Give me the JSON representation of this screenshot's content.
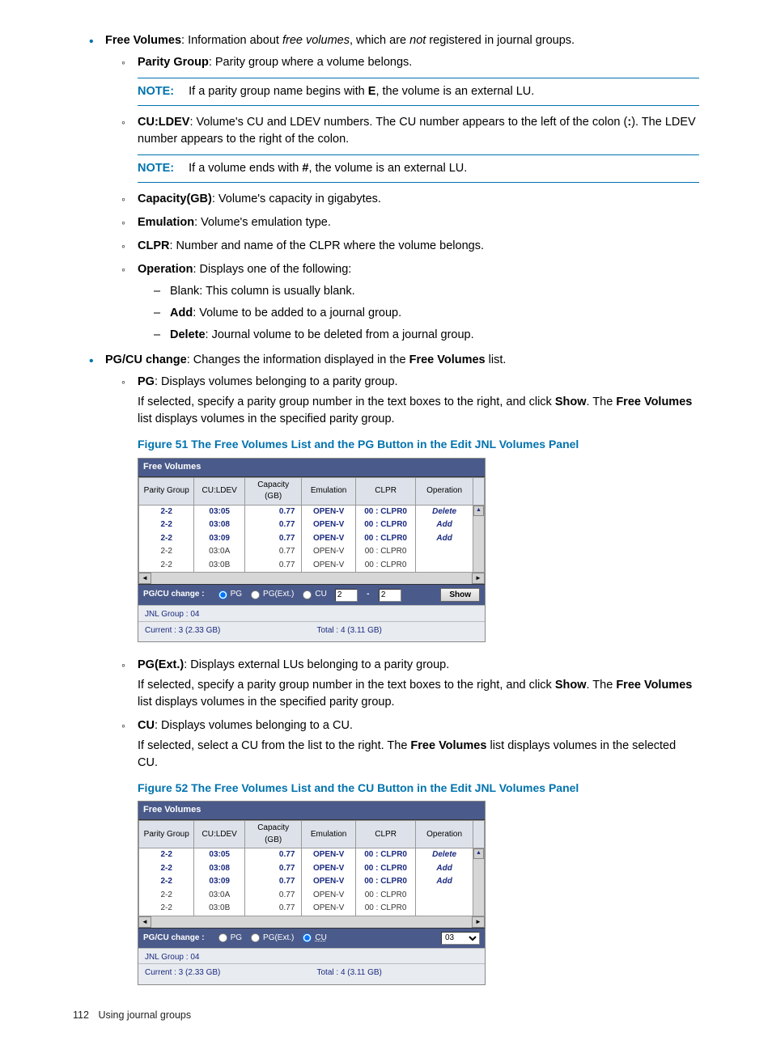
{
  "content": {
    "free_volumes_intro_a": "Free Volumes",
    "free_volumes_intro_b": ": Information about ",
    "free_volumes_intro_c": "free volumes",
    "free_volumes_intro_d": ", which are ",
    "free_volumes_intro_e": "not",
    "free_volumes_intro_f": " registered in journal groups.",
    "parity_group_label": "Parity Group",
    "parity_group_text": ": Parity group where a volume belongs.",
    "note_label": "NOTE:",
    "note1_a": "If a parity group name begins with ",
    "note1_b": "E",
    "note1_c": ", the volume is an external LU.",
    "culdev_label": "CU:LDEV",
    "culdev_a": ": Volume's CU and LDEV numbers. The CU number appears to the left of the colon (",
    "culdev_b": ":",
    "culdev_c": "). The LDEV number appears to the right of the colon.",
    "note2_a": "If a volume ends with ",
    "note2_b": "#",
    "note2_c": ", the volume is an external LU.",
    "capacity_label": "Capacity(GB)",
    "capacity_text": ": Volume's capacity in gigabytes.",
    "emulation_label": "Emulation",
    "emulation_text": ": Volume's emulation type.",
    "clpr_label": "CLPR",
    "clpr_text": ": Number and name of the CLPR where the volume belongs.",
    "operation_label": "Operation",
    "operation_text": ": Displays one of the following:",
    "op_blank": "Blank: This column is usually blank.",
    "op_add_label": "Add",
    "op_add_text": ": Volume to be added to a journal group.",
    "op_delete_label": "Delete",
    "op_delete_text": ": Journal volume to be deleted from a journal group.",
    "pgcu_change_label": "PG/CU change",
    "pgcu_change_a": ": Changes the information displayed in the ",
    "pgcu_change_b": "Free Volumes",
    "pgcu_change_c": " list.",
    "pg_label": "PG",
    "pg_text": ": Displays volumes belonging to a parity group.",
    "pg_p_a": "If selected, specify a parity group number in the text boxes to the right, and click ",
    "pg_p_b": "Show",
    "pg_p_c": ". The ",
    "pg_p_d": "Free Volumes",
    "pg_p_e": " list displays volumes in the specified parity group.",
    "fig51": "Figure 51 The Free Volumes List and the PG Button in the Edit JNL Volumes Panel",
    "pgext_label": "PG(Ext.)",
    "pgext_text": ": Displays external LUs belonging to a parity group.",
    "cu_label": "CU",
    "cu_text": ": Displays volumes belonging to a CU.",
    "cu_p_a": "If selected, select a CU from the list to the right. The ",
    "cu_p_b": "Free Volumes",
    "cu_p_c": " list displays volumes in the selected CU.",
    "fig52": "Figure 52 The Free Volumes List and the CU Button in the Edit JNL Volumes Panel"
  },
  "panel": {
    "title": "Free Volumes",
    "columns": [
      "Parity Group",
      "CU:LDEV",
      "Capacity (GB)",
      "Emulation",
      "CLPR",
      "Operation"
    ],
    "rows": [
      {
        "pg": "2-2",
        "cl": "03:05",
        "cap": "0.77",
        "em": "OPEN-V",
        "clpr": "00 : CLPR0",
        "op": "Delete",
        "bold": true,
        "opclass": "op-delete"
      },
      {
        "pg": "2-2",
        "cl": "03:08",
        "cap": "0.77",
        "em": "OPEN-V",
        "clpr": "00 : CLPR0",
        "op": "Add",
        "bold": true,
        "opclass": "op-add"
      },
      {
        "pg": "2-2",
        "cl": "03:09",
        "cap": "0.77",
        "em": "OPEN-V",
        "clpr": "00 : CLPR0",
        "op": "Add",
        "bold": true,
        "opclass": "op-add"
      },
      {
        "pg": "2-2",
        "cl": "03:0A",
        "cap": "0.77",
        "em": "OPEN-V",
        "clpr": "00 : CLPR0",
        "op": "",
        "bold": false,
        "opclass": ""
      },
      {
        "pg": "2-2",
        "cl": "03:0B",
        "cap": "0.77",
        "em": "OPEN-V",
        "clpr": "00 : CLPR0",
        "op": "",
        "bold": false,
        "opclass": ""
      }
    ],
    "pgcu_label": "PG/CU change :",
    "radios": {
      "pg": "PG",
      "pgext": "PG(Ext.)",
      "cu": "CU"
    },
    "input1": "2",
    "input2": "2",
    "show": "Show",
    "cu_select": "03",
    "jnl": "JNL Group : 04",
    "current": "Current : 3 (2.33 GB)",
    "total": "Total : 4 (3.11 GB)"
  },
  "footer": {
    "page": "112",
    "text": "Using journal groups"
  }
}
